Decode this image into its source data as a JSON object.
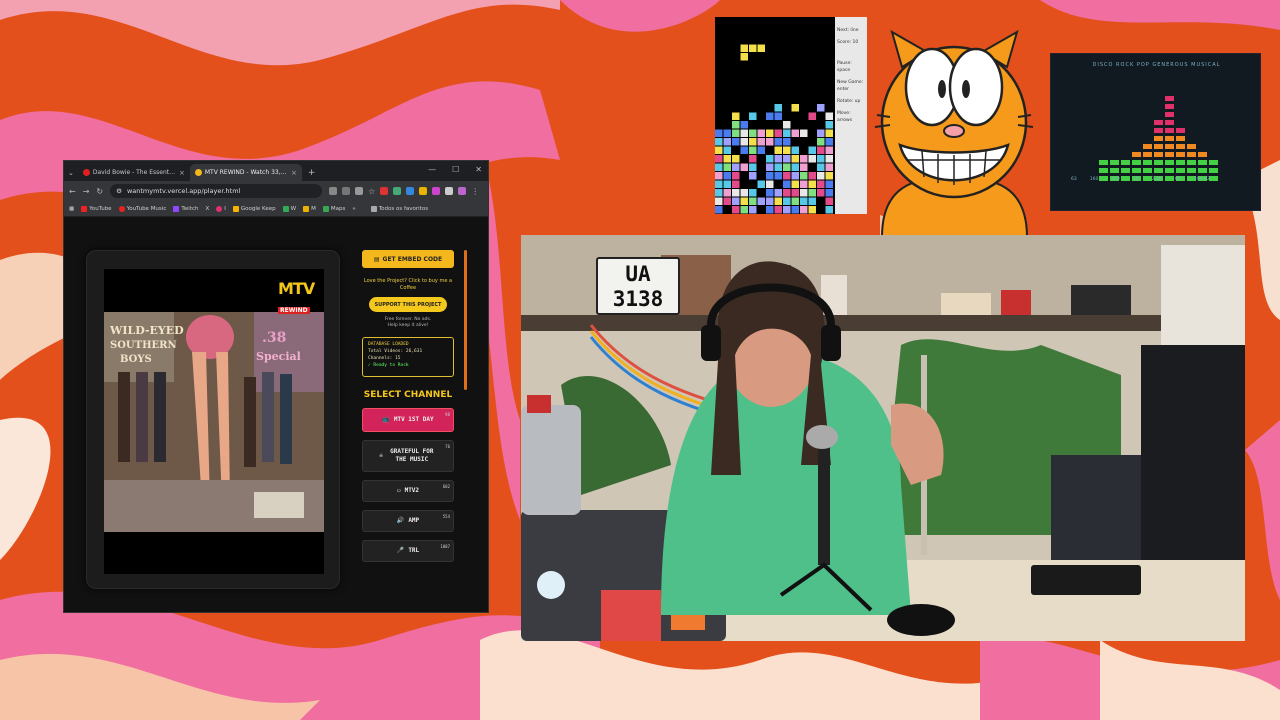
{
  "browser": {
    "tabs": [
      {
        "title": "David Bowie - The Essential Tr..."
      },
      {
        "title": "MTV REWIND - Watch 33,..."
      }
    ],
    "url": "wantmymtv.vercel.app/player.html",
    "bookmarks": [
      "YouTube",
      "YouTube Music",
      "Twitch",
      "X",
      "I",
      "Google Keep",
      "W",
      "M",
      "Maps"
    ],
    "all_bookmarks": "Todos os favoritos"
  },
  "player": {
    "logo_text": "MTV",
    "logo_sub": "REWIND"
  },
  "sidebar": {
    "embed_button": "GET EMBED CODE",
    "love_text": "Love the Project? Click to buy me a Coffee",
    "support_button": "SUPPORT THIS PROJECT",
    "tips_line1": "Free forever. No ads.",
    "tips_line2": "Help keep it alive!",
    "db_title": "DATABASE LOADED",
    "db_total": "Total Videos: 26,631",
    "db_channels": "Channels: 15",
    "db_status": "✓ Ready to Rock",
    "select_channel": "SELECT CHANNEL",
    "channels": [
      {
        "label": "MTV 1ST DAY",
        "count": "98"
      },
      {
        "label": "GRATEFUL FOR THE MUSIC",
        "count": "76"
      },
      {
        "label": "MTV2",
        "count": "602"
      },
      {
        "label": "AMP",
        "count": "554"
      },
      {
        "label": "TRL",
        "count": "1007"
      }
    ]
  },
  "tetris": {
    "next": "Next: line",
    "score": "Score: 10",
    "pause": "Pause: space",
    "new_game": "New Game: enter",
    "rotate": "Rotate: up",
    "move": "Move: arrows"
  },
  "equalizer": {
    "title": "DISCO ROCK  POP GENEROUS MUSICAL",
    "freqs": [
      "63",
      "160",
      "400",
      "1K",
      "2.5K",
      "6K",
      "16K HZ"
    ]
  },
  "webcam": {
    "plate_line1": "UA",
    "plate_line2": "3138"
  },
  "colors": {
    "accent_yellow": "#f4c81c",
    "active_channel": "#d2245a",
    "bg_orange": "#e4501c",
    "bg_pink": "#f06ea0"
  }
}
